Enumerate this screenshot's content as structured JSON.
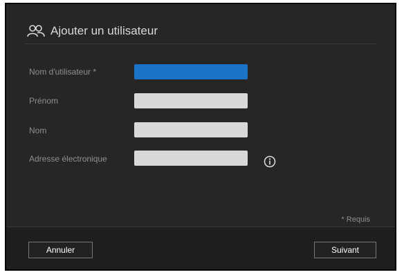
{
  "dialog": {
    "title": "Ajouter un utilisateur",
    "title_icon": "users-icon"
  },
  "form": {
    "fields": [
      {
        "label": "Nom d'utilisateur *",
        "value": "",
        "placeholder": "",
        "focused": true
      },
      {
        "label": "Prénom",
        "value": "",
        "placeholder": ""
      },
      {
        "label": "Nom",
        "value": "",
        "placeholder": ""
      },
      {
        "label": "Adresse électronique",
        "value": "",
        "placeholder": "",
        "icon": "info-icon"
      }
    ],
    "required_note": "* Requis"
  },
  "footer": {
    "cancel_label": "Annuler",
    "next_label": "Suivant"
  },
  "colors": {
    "dialog_bg": "#262626",
    "field_bg": "#d8d8d8",
    "active_field": "#1a73c7",
    "label_text": "#8f8f8f"
  }
}
